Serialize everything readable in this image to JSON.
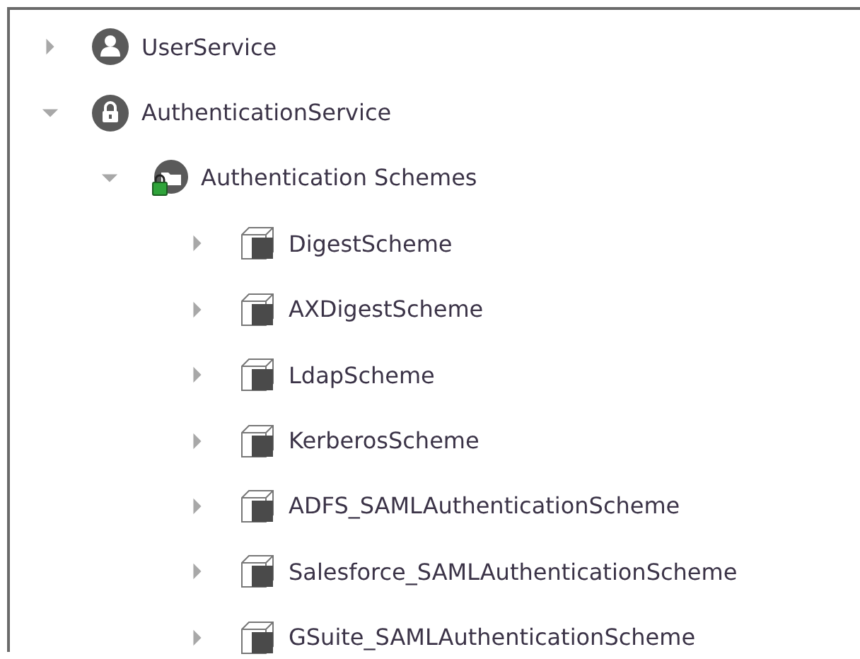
{
  "tree": [
    {
      "label": "UserService",
      "kind": "user",
      "expanded": false
    },
    {
      "label": "AuthenticationService",
      "kind": "lock",
      "expanded": true,
      "children": [
        {
          "label": "Authentication Schemes",
          "kind": "folder",
          "expanded": true,
          "children": [
            {
              "label": "DigestScheme",
              "kind": "component",
              "expanded": false
            },
            {
              "label": "AXDigestScheme",
              "kind": "component",
              "expanded": false
            },
            {
              "label": "LdapScheme",
              "kind": "component",
              "expanded": false
            },
            {
              "label": "KerberosScheme",
              "kind": "component",
              "expanded": false
            },
            {
              "label": "ADFS_SAMLAuthenticationScheme",
              "kind": "component",
              "expanded": false
            },
            {
              "label": "Salesforce_SAMLAuthenticationScheme",
              "kind": "component",
              "expanded": false
            },
            {
              "label": "GSuite_SAMLAuthenticationScheme",
              "kind": "component",
              "expanded": false
            }
          ]
        }
      ]
    }
  ]
}
